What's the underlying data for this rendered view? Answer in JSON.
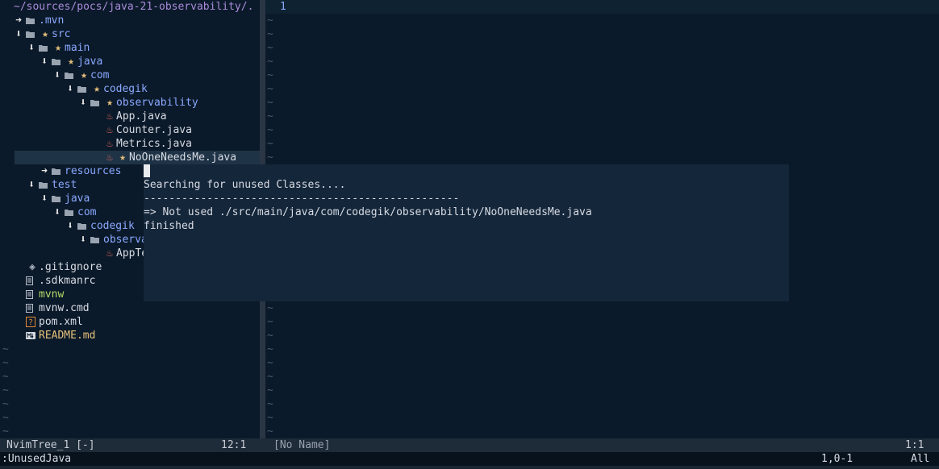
{
  "tree": {
    "header": "~/sources/pocs/java-21-observability/.",
    "items": [
      {
        "arrow": "➜",
        "icon": "folder",
        "star": false,
        "label": ".mvn",
        "kind": "dir"
      },
      {
        "arrow": "⬇",
        "icon": "folder",
        "star": true,
        "label": "src",
        "kind": "dir"
      },
      {
        "arrow": "⬇",
        "icon": "folder",
        "star": true,
        "label": "main",
        "kind": "dir"
      },
      {
        "arrow": "⬇",
        "icon": "folder",
        "star": true,
        "label": "java",
        "kind": "dir"
      },
      {
        "arrow": "⬇",
        "icon": "folder",
        "star": true,
        "label": "com",
        "kind": "dir"
      },
      {
        "arrow": "⬇",
        "icon": "folder",
        "star": true,
        "label": "codegik",
        "kind": "dir"
      },
      {
        "arrow": "⬇",
        "icon": "folder",
        "star": true,
        "label": "observability",
        "kind": "dir"
      },
      {
        "icon": "java",
        "star": false,
        "label": "App.java",
        "kind": "file"
      },
      {
        "icon": "java",
        "star": false,
        "label": "Counter.java",
        "kind": "file"
      },
      {
        "icon": "java",
        "star": false,
        "label": "Metrics.java",
        "kind": "file"
      },
      {
        "icon": "java",
        "star": true,
        "label": "NoOneNeedsMe.java",
        "kind": "file",
        "selected": true
      },
      {
        "arrow": "➜",
        "icon": "folder",
        "star": false,
        "label": "resources",
        "kind": "dir"
      },
      {
        "arrow": "⬇",
        "icon": "folder",
        "star": false,
        "label": "test",
        "kind": "dir"
      },
      {
        "arrow": "⬇",
        "icon": "folder",
        "star": false,
        "label": "java",
        "kind": "dir"
      },
      {
        "arrow": "⬇",
        "icon": "folder",
        "star": false,
        "label": "com",
        "kind": "dir"
      },
      {
        "arrow": "⬇",
        "icon": "folder",
        "star": false,
        "label": "codegik",
        "kind": "dir"
      },
      {
        "arrow": "⬇",
        "icon": "folder",
        "star": false,
        "label": "observability",
        "kind": "dir"
      },
      {
        "icon": "java",
        "star": false,
        "label": "AppTest.java",
        "kind": "file"
      },
      {
        "icon": "git",
        "star": false,
        "label": ".gitignore",
        "kind": "file"
      },
      {
        "icon": "doc",
        "star": false,
        "label": ".sdkmanrc",
        "kind": "file"
      },
      {
        "icon": "doc",
        "star": false,
        "label": "mvnw",
        "kind": "exec"
      },
      {
        "icon": "doc",
        "star": false,
        "label": "mvnw.cmd",
        "kind": "file"
      },
      {
        "icon": "unknown",
        "star": false,
        "label": "pom.xml",
        "kind": "file"
      },
      {
        "icon": "markdown",
        "star": false,
        "label": "README.md",
        "kind": "markdown"
      }
    ]
  },
  "icons": {
    "folder": "folder-icon",
    "java": "java-icon",
    "git": "git-icon",
    "doc": "file-icon",
    "unknown": "unknown-file-icon",
    "markdown": "markdown-icon"
  },
  "editor": {
    "line_number": "1"
  },
  "popup": {
    "lines": [
      "Searching for unused Classes....",
      "--------------------------------------------------",
      "=> Not used ./src/main/java/com/codegik/observability/NoOneNeedsMe.java",
      "finished"
    ]
  },
  "statusline": {
    "left_name": "NvimTree_1 [-]",
    "left_pos": "12:1",
    "right_name": "[No Name]",
    "right_pos": "1:1"
  },
  "cmdline": {
    "command": ":UnusedJava",
    "ruler": "1,0-1",
    "scroll": "All"
  },
  "colors": {
    "background": "#0b1a2a",
    "directory": "#8aa8ff",
    "star": "#e5c07b",
    "exec": "#b6d96a",
    "markdown": "#e5c07b",
    "java_icon": "#e0695a"
  }
}
